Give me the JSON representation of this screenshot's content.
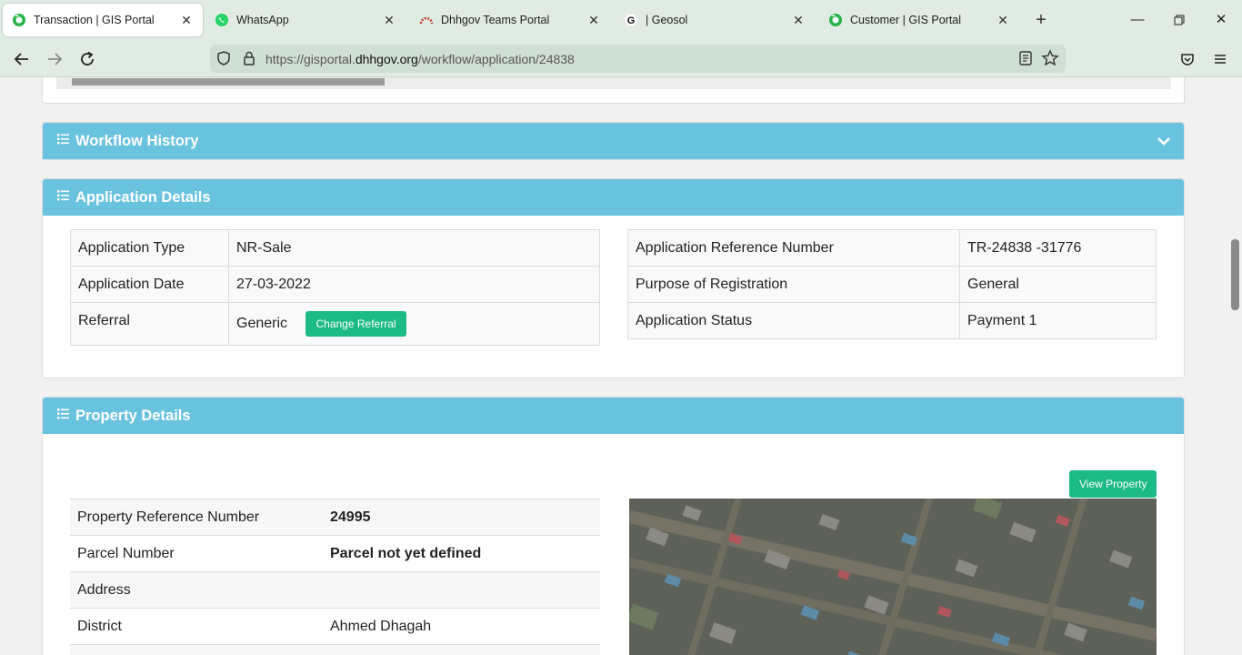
{
  "browser": {
    "tabs": [
      {
        "title": "Transaction | GIS Portal",
        "icon": "gis-portal-icon",
        "active": true
      },
      {
        "title": "WhatsApp",
        "icon": "whatsapp-icon",
        "active": false
      },
      {
        "title": "Dhhgov Teams Portal",
        "icon": "teams-portal-icon",
        "active": false
      },
      {
        "title": "| Geosol",
        "icon": "google-icon",
        "active": false
      },
      {
        "title": "Customer | GIS Portal",
        "icon": "gis-portal-icon",
        "active": false
      }
    ],
    "url_prefix": "https://gisportal.",
    "url_domain": "dhhgov.org",
    "url_path": "/workflow/application/24838"
  },
  "sections": {
    "workflow_history": {
      "title": "Workflow History"
    },
    "application_details": {
      "title": "Application Details",
      "left": [
        {
          "label": "Application Type",
          "value": "NR-Sale"
        },
        {
          "label": "Application Date",
          "value": "27-03-2022"
        },
        {
          "label": "Referral",
          "value": "Generic"
        }
      ],
      "change_referral_label": "Change Referral",
      "right": [
        {
          "label": "Application Reference Number",
          "value": "TR-24838 -31776"
        },
        {
          "label": "Purpose of Registration",
          "value": "General"
        },
        {
          "label": "Application Status",
          "value": "Payment 1"
        }
      ]
    },
    "property_details": {
      "title": "Property Details",
      "view_property_label": "View Property",
      "rows": [
        {
          "label": "Property Reference Number",
          "value": "24995"
        },
        {
          "label": "Parcel Number",
          "value": "Parcel not yet defined"
        },
        {
          "label": "Address",
          "value": ""
        },
        {
          "label": "District",
          "value": "Ahmed Dhagah"
        }
      ]
    }
  },
  "colors": {
    "header": "#69c3df",
    "button": "#1cba84",
    "browser_chrome": "#e0ebe4"
  }
}
